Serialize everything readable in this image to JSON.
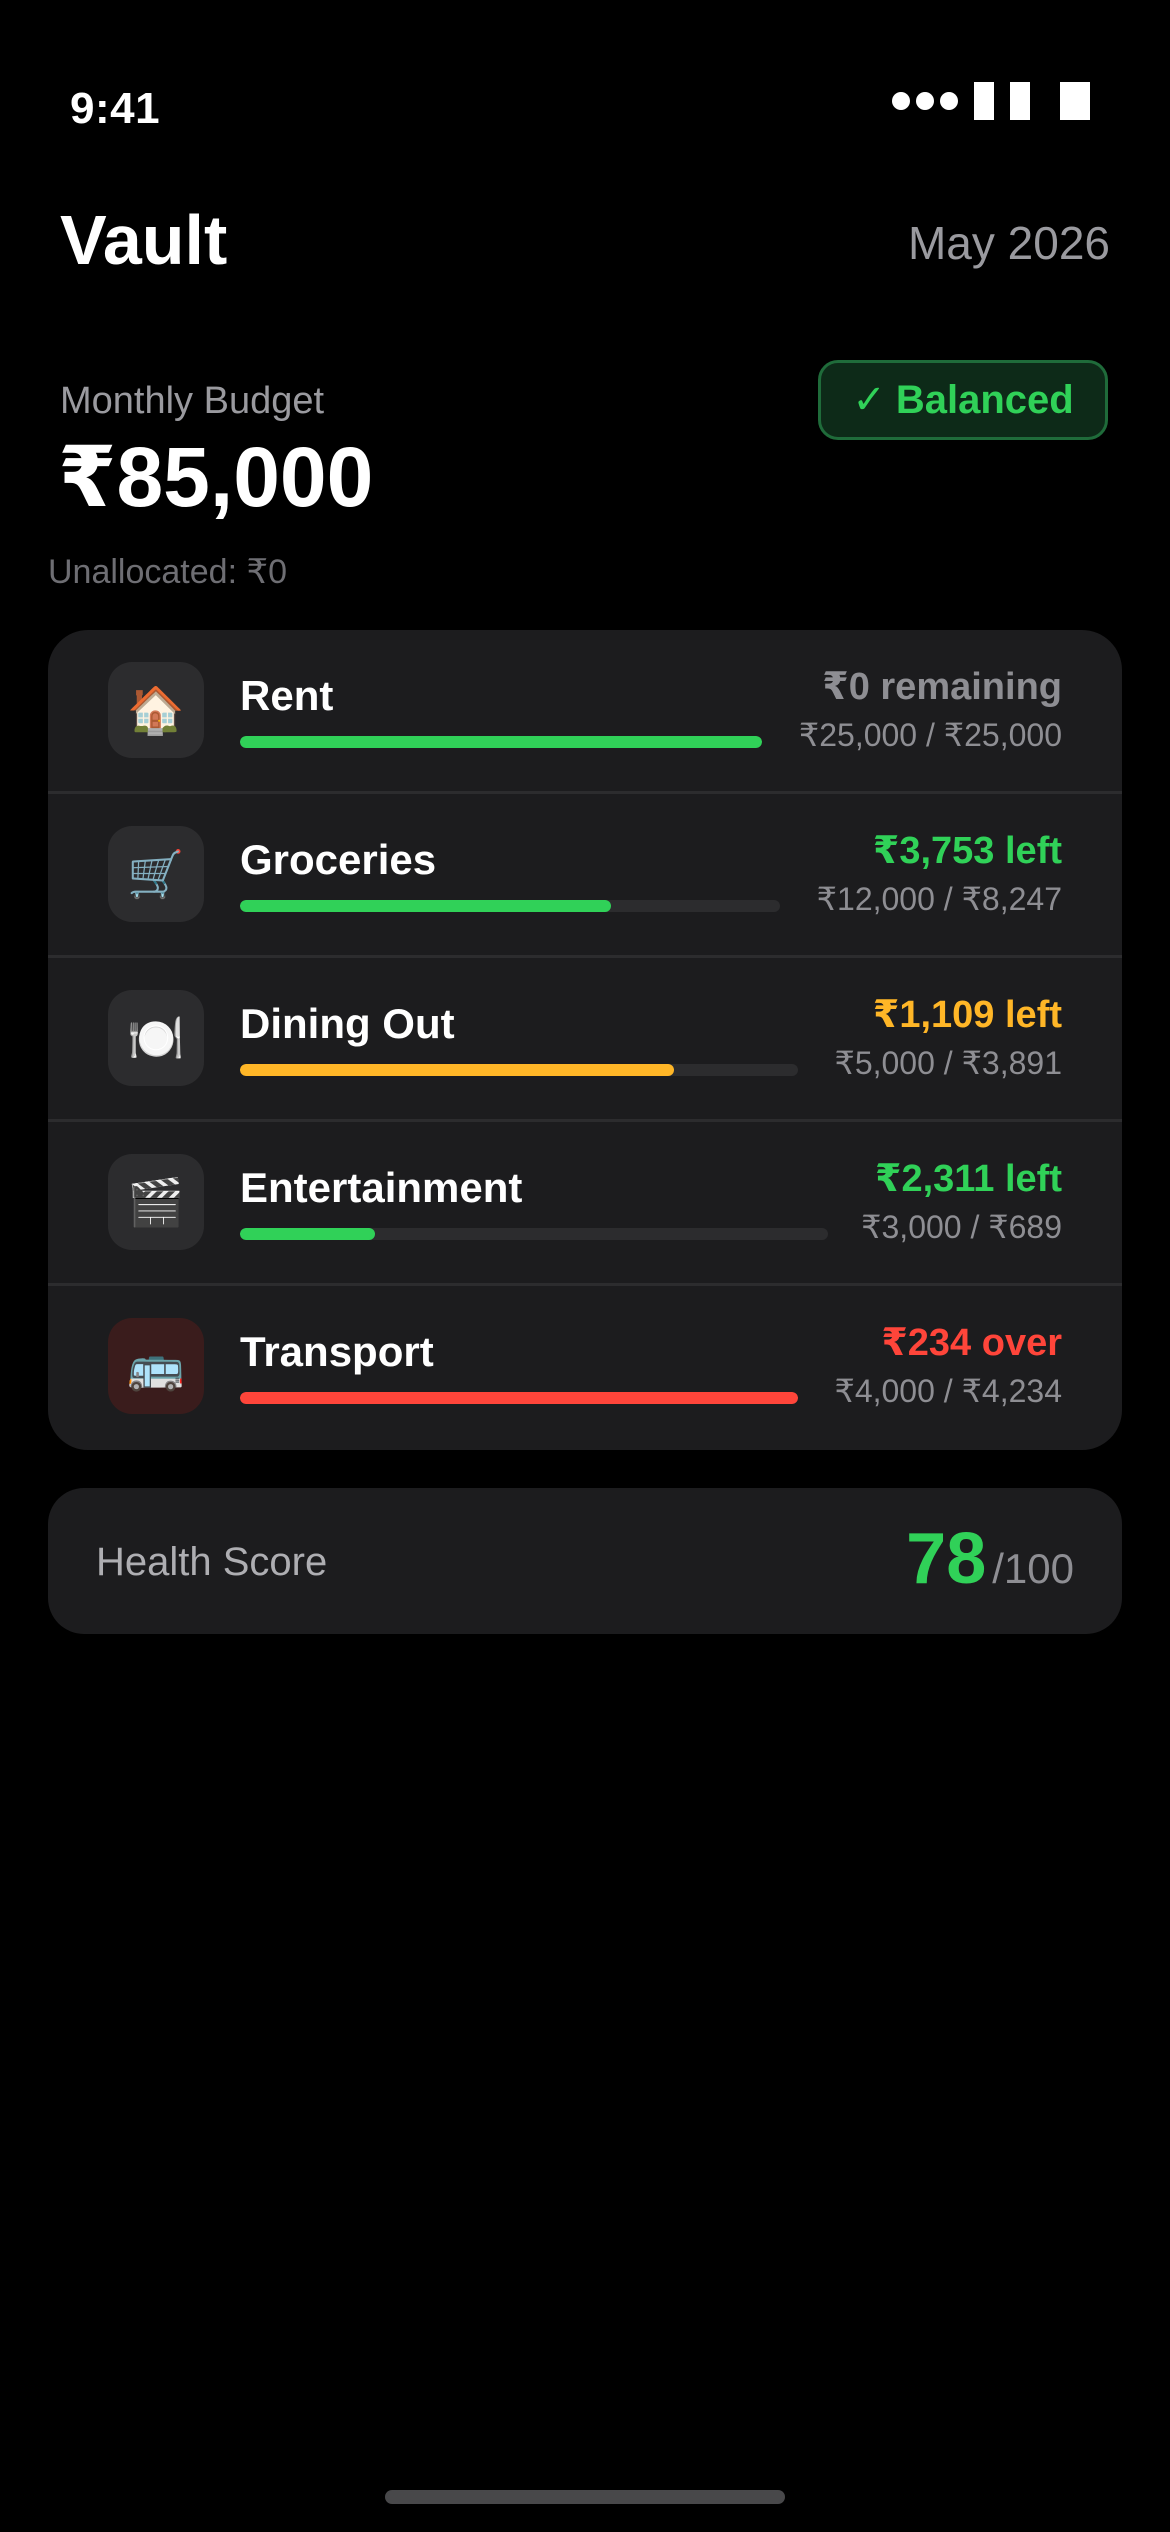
{
  "status_bar": {
    "time": "9:41"
  },
  "header": {
    "app_title": "Vault",
    "period": "May 2026"
  },
  "budget": {
    "label": "Monthly Budget",
    "amount": "₹85,000",
    "badge_check": "✓",
    "badge_label": "Balanced",
    "unallocated": "Unallocated: ₹0"
  },
  "categories": [
    {
      "name": "Rent",
      "icon": "house-icon",
      "glyph": "🏠",
      "status": "₹0 remaining",
      "detail": "₹25,000 / ₹25,000",
      "progress": 1.0,
      "status_color": "#8e8e93",
      "bar_color": "#30d158"
    },
    {
      "name": "Groceries",
      "icon": "shopping-cart-icon",
      "glyph": "🛒",
      "status": "₹3,753 left",
      "detail": "₹12,000 / ₹8,247",
      "progress": 0.687,
      "status_color": "#30d158",
      "bar_color": "#30d158"
    },
    {
      "name": "Dining Out",
      "icon": "plate-cutlery-icon",
      "glyph": "🍽️",
      "status": "₹1,109 left",
      "detail": "₹5,000 / ₹3,891",
      "progress": 0.778,
      "status_color": "#ffb627",
      "bar_color": "#ffb627"
    },
    {
      "name": "Entertainment",
      "icon": "clapperboard-icon",
      "glyph": "🎬",
      "status": "₹2,311 left",
      "detail": "₹3,000 / ₹689",
      "progress": 0.23,
      "status_color": "#30d158",
      "bar_color": "#30d158"
    },
    {
      "name": "Transport",
      "icon": "bus-icon",
      "glyph": "🚌",
      "status": "₹234 over",
      "detail": "₹4,000 / ₹4,234",
      "progress": 1.0,
      "status_color": "#ff453a",
      "bar_color": "#ff453a"
    }
  ],
  "health": {
    "label": "Health Score",
    "value": "78",
    "max": "/100"
  },
  "colors": {
    "background": "#000000",
    "card": "#1c1c1e",
    "positive": "#30d158",
    "warning": "#ffb627",
    "negative": "#ff453a",
    "muted": "#8e8e93"
  }
}
